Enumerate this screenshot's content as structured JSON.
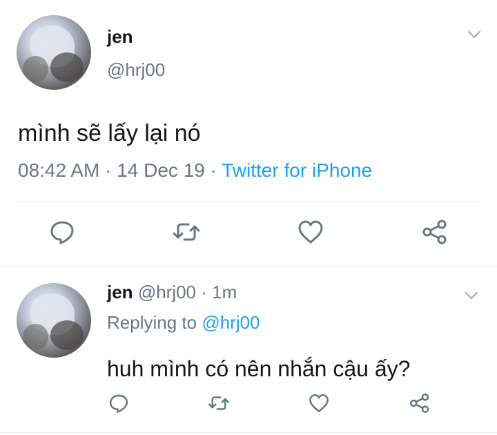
{
  "main_tweet": {
    "name": "jen",
    "handle": "@hrj00",
    "text": "mình sẽ lấy lại nó",
    "time": "08:42 AM",
    "separator": " · ",
    "date": "14 Dec 19",
    "source": "Twitter for iPhone"
  },
  "reply_tweet": {
    "name": "jen",
    "handle": "@hrj00",
    "dot": " · ",
    "time": "1m",
    "replying_label": "Replying to ",
    "replying_to": "@hrj00",
    "text": "huh mình có nên nhắn cậu ấy?"
  },
  "colors": {
    "link": "#1da1f2",
    "secondary": "#657786",
    "icon": "#657786",
    "text": "#14171a",
    "divider": "#e1e8ed"
  },
  "icons": [
    "chevron-down-icon",
    "reply-icon",
    "retweet-icon",
    "like-icon",
    "share-icon"
  ]
}
